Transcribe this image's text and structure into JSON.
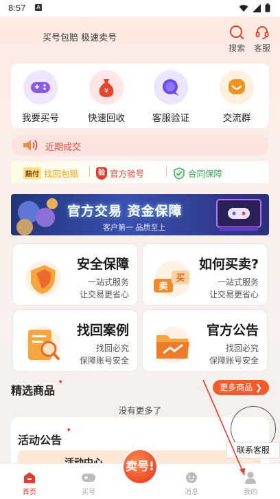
{
  "status_bar": {
    "time": "8:57",
    "notif_letter": "A"
  },
  "header": {
    "slogan": "买号包赔 极速卖号",
    "search_label": "搜索",
    "service_label": "客服"
  },
  "quick_actions": [
    {
      "label": "我要买号",
      "icon": "gamepad-icon",
      "color": "#8a59f0"
    },
    {
      "label": "快速回收",
      "icon": "money-bag-icon",
      "color": "#e8432f"
    },
    {
      "label": "客服验证",
      "icon": "chat-bubble-icon",
      "color": "#6b48ea"
    },
    {
      "label": "交流群",
      "icon": "smile-chat-icon",
      "color": "#f19322"
    }
  ],
  "recent_deals": {
    "label": "近期成交"
  },
  "guarantees": [
    {
      "tag": "赔付",
      "label": "找回包赔",
      "color": "#e8a21a"
    },
    {
      "tag": "验",
      "label": "官方验号",
      "color": "#e23b30"
    },
    {
      "tag": "",
      "label": "合同保障",
      "color": "#3aa655"
    }
  ],
  "banner": {
    "headline": "官方交易 资金保障",
    "subline": "客户第一 品质至上"
  },
  "features": [
    {
      "title": "安全保障",
      "line1": "一站式服务",
      "line2": "让交易更省心"
    },
    {
      "title": "如何买卖?",
      "line1": "一站式服务",
      "line2": "让交易更省心",
      "icon_text1": "卖",
      "icon_text2": "买"
    },
    {
      "title": "找回案例",
      "line1": "找回必究",
      "line2": "保障账号安全"
    },
    {
      "title": "官方公告",
      "line1": "找回必究",
      "line2": "保障账号安全"
    }
  ],
  "selected": {
    "title": "精选商品",
    "more_label": "更多商品",
    "empty_text": "没有更多了"
  },
  "notice": {
    "title": "活动公告",
    "partial_text": "活动中心"
  },
  "floating": {
    "label": "联系客服"
  },
  "tabbar": {
    "items": [
      {
        "label": "首页",
        "active": true
      },
      {
        "label": "买号",
        "active": false
      },
      {
        "label": "消息",
        "active": false
      },
      {
        "label": "我的",
        "active": false
      }
    ],
    "sell_label": "卖号!"
  },
  "colors": {
    "accent": "#e23b30",
    "orange": "#f25c2c"
  }
}
